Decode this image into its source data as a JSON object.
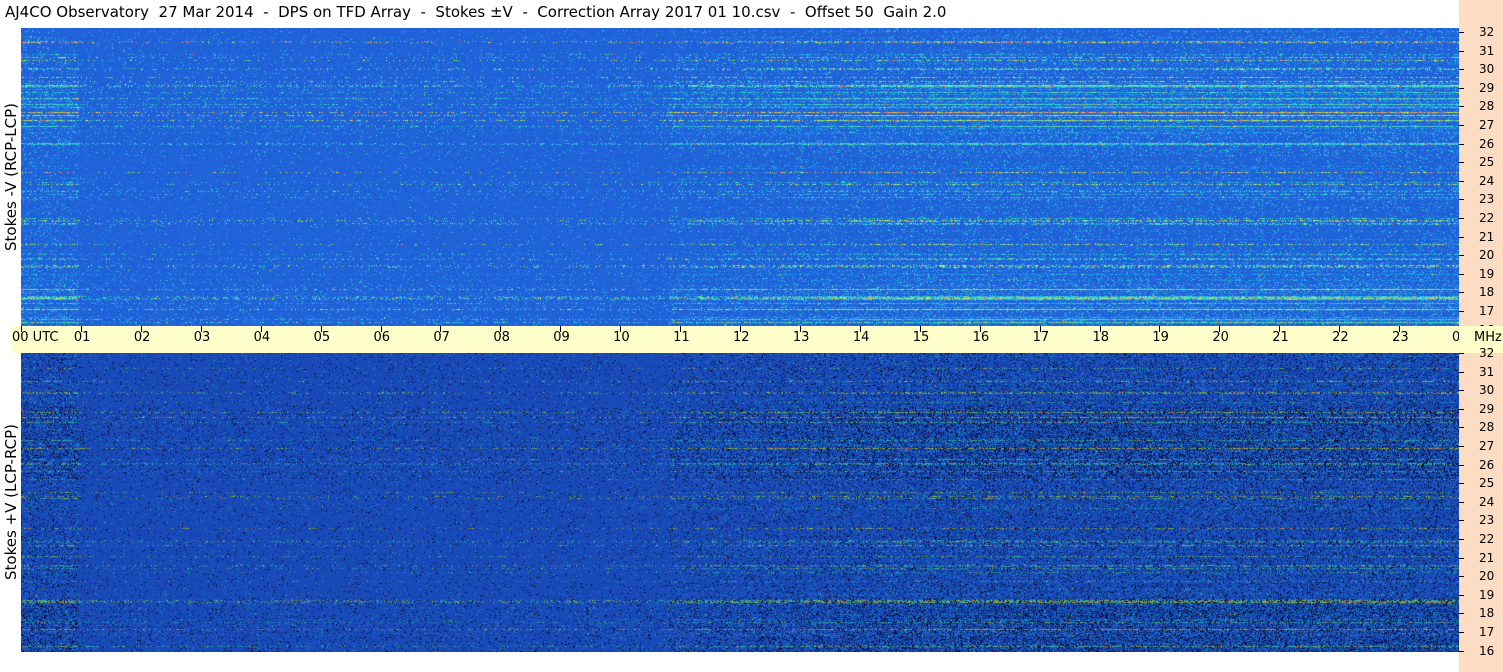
{
  "title": "AJ4CO Observatory  27 Mar 2014  -  DPS on TFD Array  -  Stokes ±V  -  Correction Array 2017 01 10.csv  -  Offset 50  Gain 2.0",
  "panels": [
    {
      "id": "top",
      "ylabel": "Stokes -V (RCP-LCP)"
    },
    {
      "id": "bottom",
      "ylabel": "Stokes +V (LCP-RCP)"
    }
  ],
  "freq_labels": [
    "32",
    "31",
    "30",
    "29",
    "28",
    "27",
    "26",
    "25",
    "24",
    "23",
    "22",
    "21",
    "20",
    "19",
    "18",
    "17",
    "16"
  ],
  "utc_labels": [
    "00",
    "01",
    "02",
    "03",
    "04",
    "05",
    "06",
    "07",
    "08",
    "09",
    "10",
    "11",
    "12",
    "13",
    "14",
    "15",
    "16",
    "17",
    "18",
    "19",
    "20",
    "21",
    "22",
    "23",
    "00"
  ],
  "utc_unit": "UTC",
  "freq_unit": "MHz",
  "colors": {
    "freq_axis_bg": "#fddcc4",
    "time_axis_bg": "#ffffcc",
    "spectrogram_base": "#1f55d6"
  }
}
